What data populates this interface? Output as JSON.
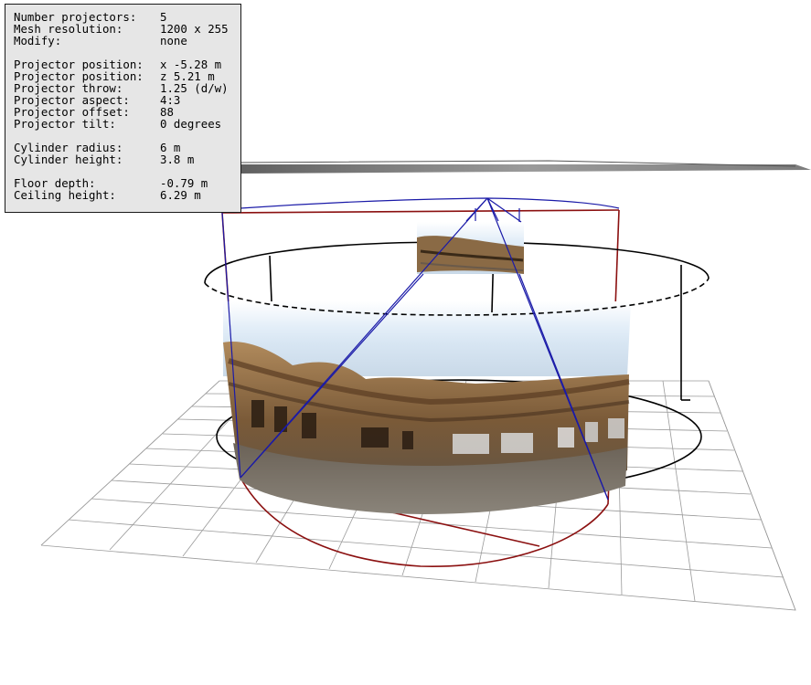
{
  "info": {
    "group1": [
      {
        "label": "Number projectors:",
        "value": "5"
      },
      {
        "label": "Mesh resolution:",
        "value": "1200 x 255"
      },
      {
        "label": "Modify:",
        "value": "none"
      }
    ],
    "group2": [
      {
        "label": "Projector position:",
        "value": "x -5.28 m"
      },
      {
        "label": "Projector position:",
        "value": "z 5.21 m"
      },
      {
        "label": "Projector throw:",
        "value": "1.25 (d/w)"
      },
      {
        "label": "Projector aspect:",
        "value": "4:3"
      },
      {
        "label": "Projector offset:",
        "value": "88"
      },
      {
        "label": "Projector tilt:",
        "value": "0 degrees"
      }
    ],
    "group3": [
      {
        "label": "Cylinder radius:",
        "value": "6 m"
      },
      {
        "label": "Cylinder height:",
        "value": "3.8 m"
      }
    ],
    "group4": [
      {
        "label": "Floor depth:",
        "value": "-0.79 m"
      },
      {
        "label": "Ceiling height:",
        "value": "6.29 m"
      }
    ]
  },
  "scene": {
    "colors": {
      "grid": "#9a9a9a",
      "cylinder_outline": "#000000",
      "ceiling_frame": "#8b1010",
      "projector_frustum": "#1a1aa8",
      "panel_bg": "#e6e6e6",
      "sky": "#e8f2fa",
      "stone": "#8a6a45"
    }
  }
}
